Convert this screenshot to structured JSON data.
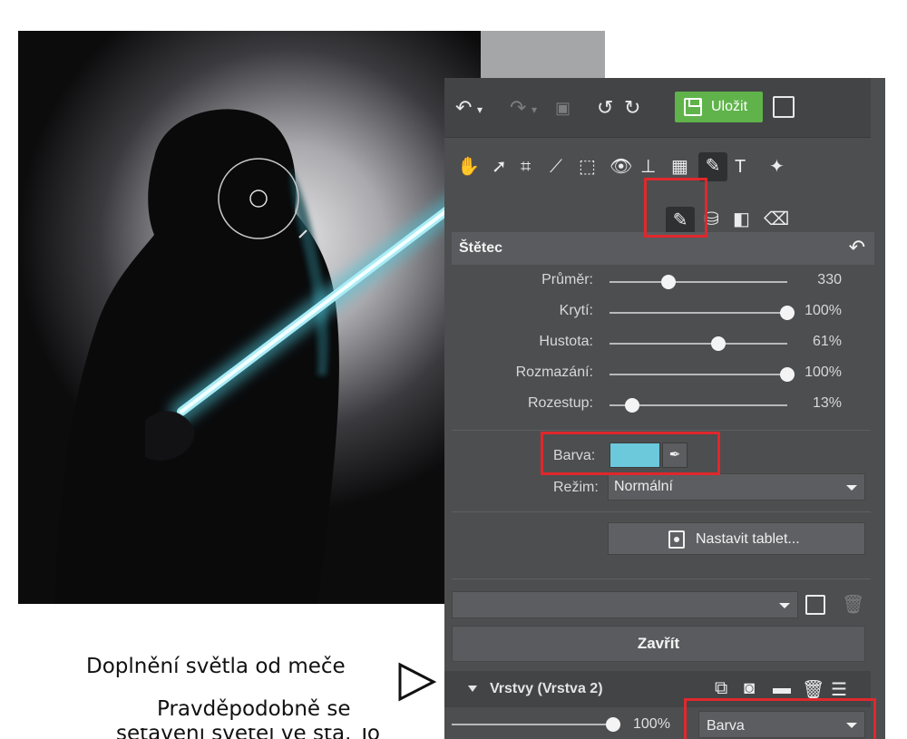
{
  "toolbar": {
    "save_label": "Uložit"
  },
  "brush_panel": {
    "title": "Štětec",
    "sliders": [
      {
        "label": "Průměr:",
        "value": "330",
        "fraction": 0.33
      },
      {
        "label": "Krytí:",
        "value": "100%",
        "fraction": 1.0
      },
      {
        "label": "Hustota:",
        "value": "61%",
        "fraction": 0.61
      },
      {
        "label": "Rozmazání:",
        "value": "100%",
        "fraction": 1.0
      },
      {
        "label": "Rozestup:",
        "value": "13%",
        "fraction": 0.13
      }
    ],
    "color_label": "Barva:",
    "color_value": "#6cc9dc",
    "mode_label": "Režim:",
    "mode_value": "Normální",
    "tablet_button": "Nastavit tablet...",
    "close_button": "Zavřít"
  },
  "layers": {
    "title": "Vrstvy (Vrstva 2)",
    "opacity": "100%",
    "blend_mode": "Barva"
  },
  "captions": {
    "line1": "Doplnění světla od meče",
    "line2": "Pravděpodobně se",
    "line3": "setavení světél ve sta. To"
  },
  "colors": {
    "accent_save": "#5fb34a",
    "highlight_red": "#e0282c",
    "saber": "#6cc9dc"
  }
}
